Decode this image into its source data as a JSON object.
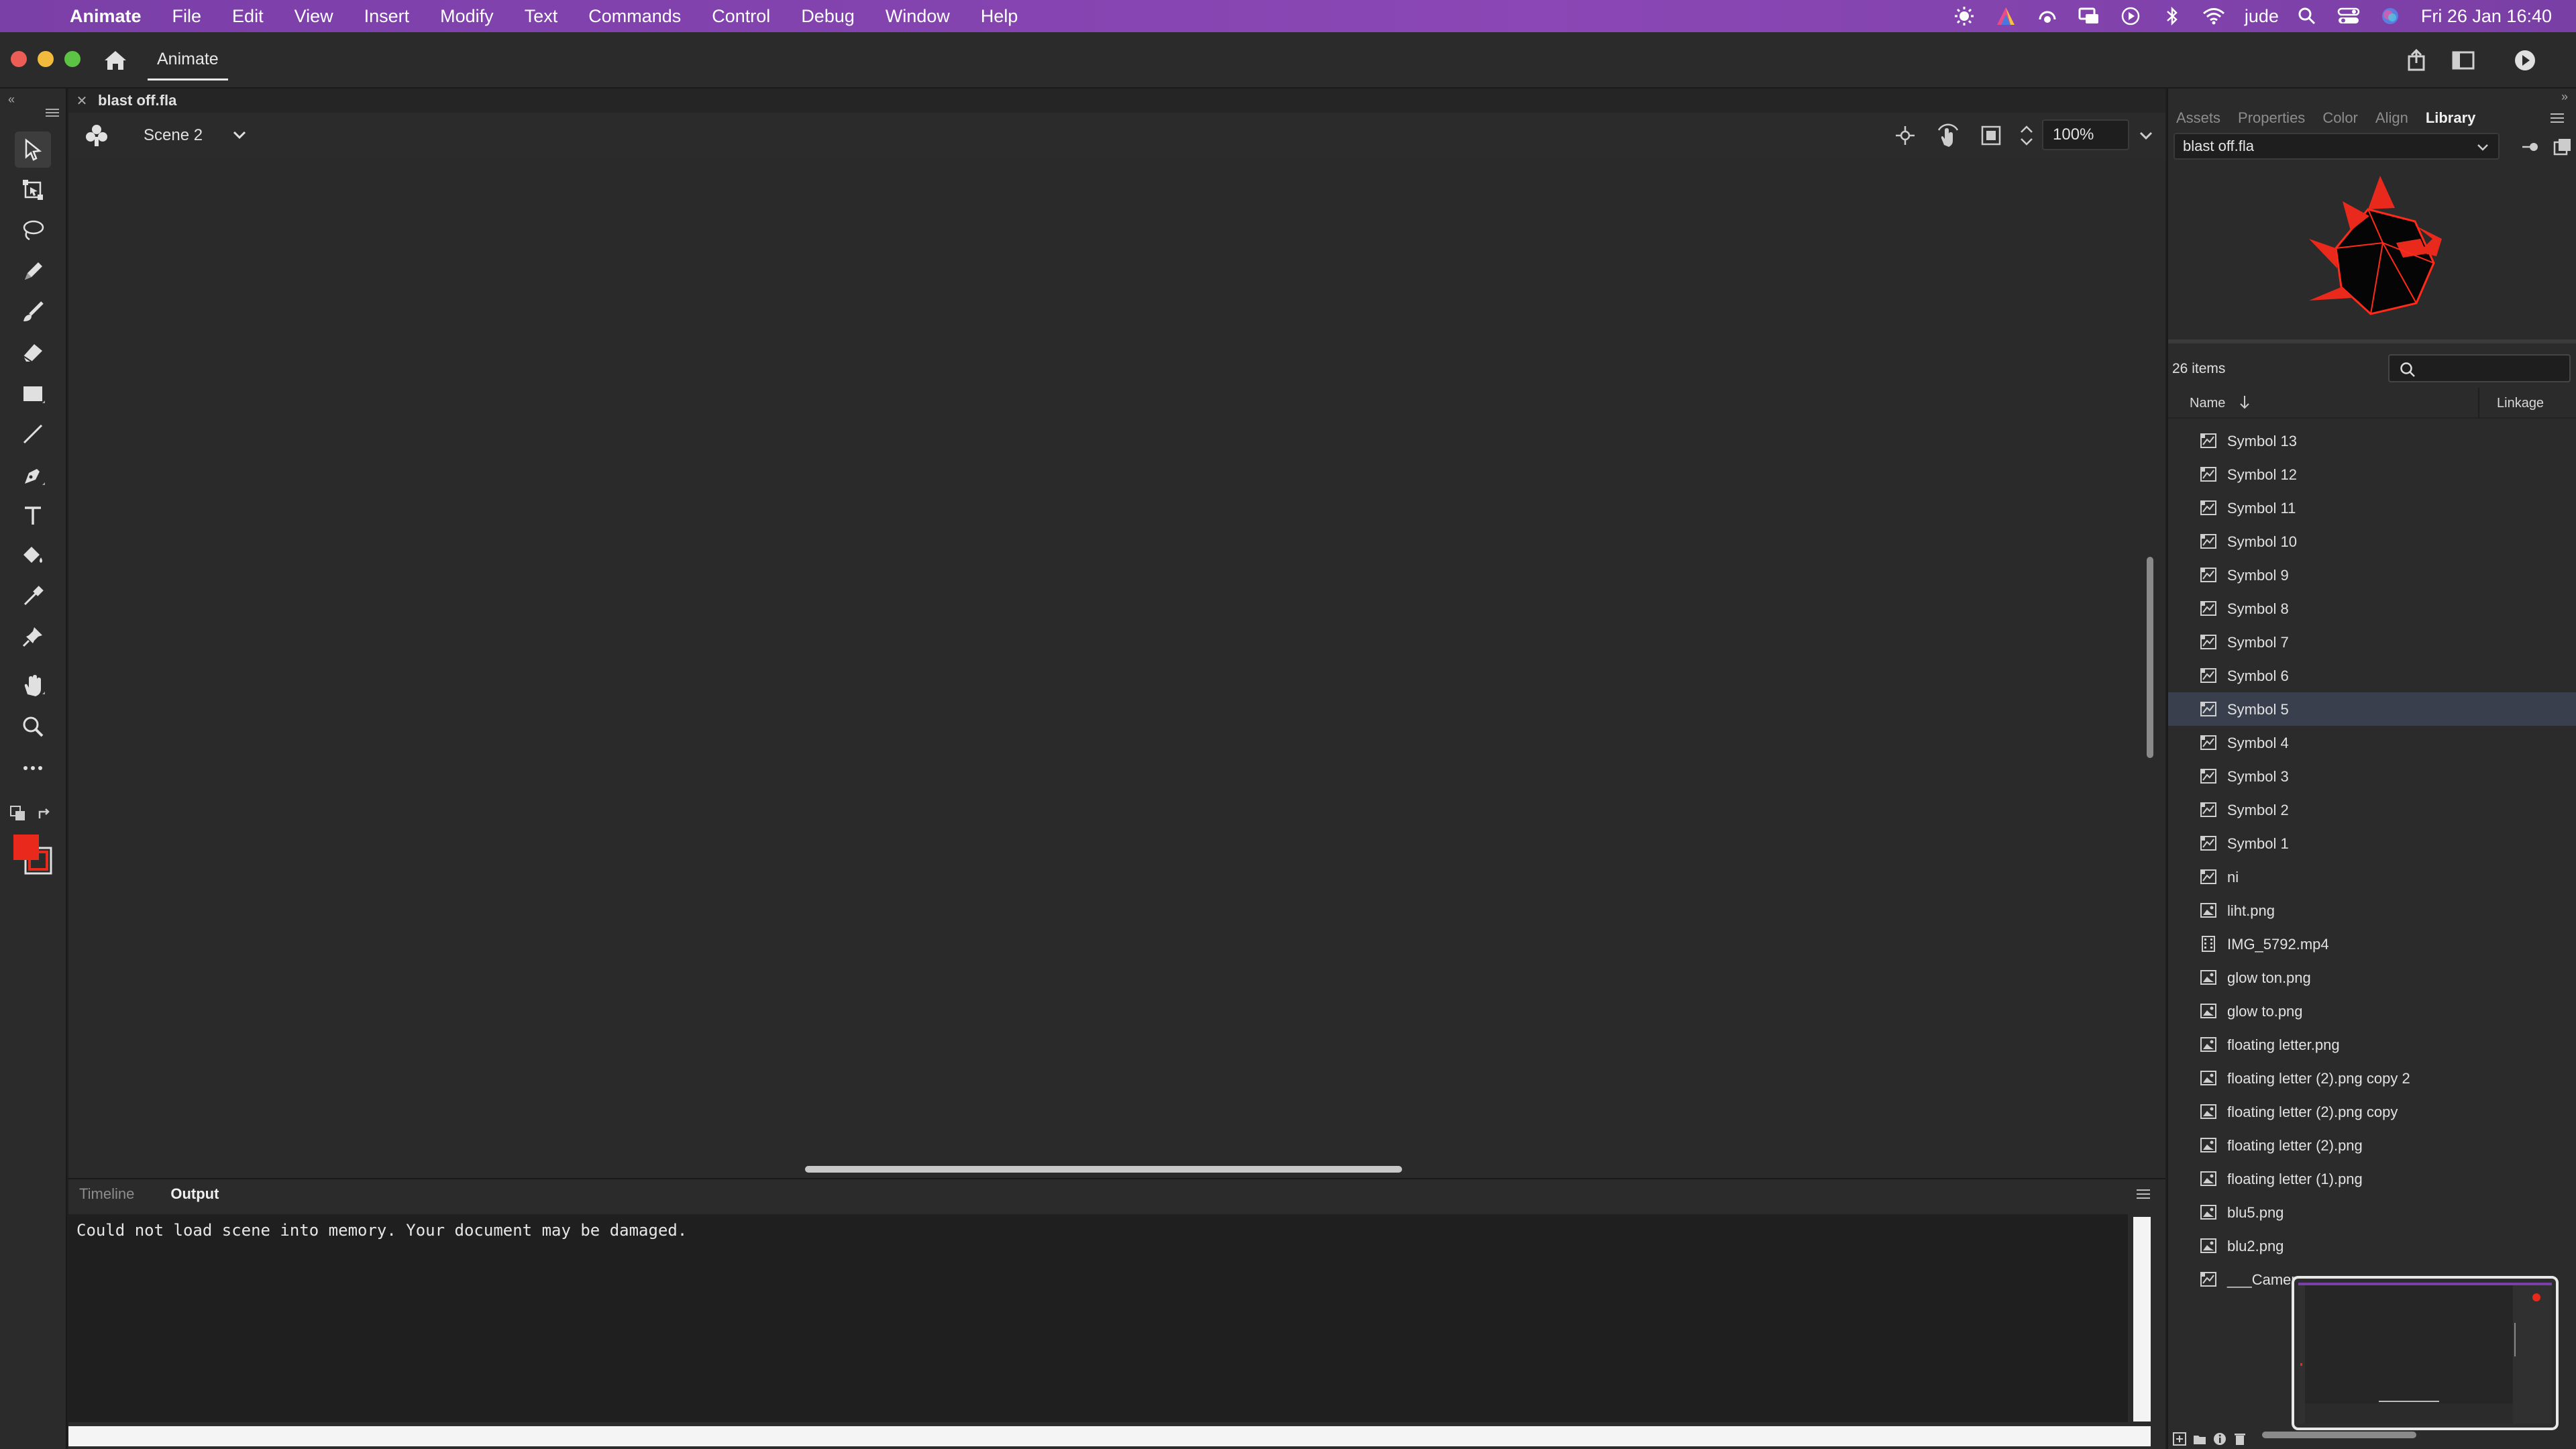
{
  "menubar": {
    "app_name": "Animate",
    "items": [
      "File",
      "Edit",
      "View",
      "Insert",
      "Modify",
      "Text",
      "Commands",
      "Control",
      "Debug",
      "Window",
      "Help"
    ],
    "user": "jude",
    "datetime": "Fri 26 Jan  16:40",
    "status_icons": [
      "brightness-icon",
      "creative-cloud-icon",
      "sync-icon",
      "screen-mirror-icon",
      "play-circle-icon",
      "bluetooth-icon",
      "wifi-icon",
      "search-icon",
      "control-center-icon",
      "siri-icon"
    ]
  },
  "appbar": {
    "tab_label": "Animate"
  },
  "document": {
    "tab_name": "blast off.fla",
    "scene": "Scene 2",
    "zoom": "100%"
  },
  "bottom_panel": {
    "tabs": [
      "Timeline",
      "Output"
    ],
    "active_tab": "Output",
    "output_text": "Could not load scene into memory. Your document may be damaged."
  },
  "right_panel": {
    "tabs": [
      "Assets",
      "Properties",
      "Color",
      "Align",
      "Library"
    ],
    "active_tab": "Library",
    "library_select": "blast off.fla",
    "items_count": "26 items",
    "col_name": "Name",
    "col_linkage": "Linkage",
    "items": [
      {
        "label": "Symbol 13",
        "kind": "symbol"
      },
      {
        "label": "Symbol 12",
        "kind": "symbol"
      },
      {
        "label": "Symbol 11",
        "kind": "symbol"
      },
      {
        "label": "Symbol 10",
        "kind": "symbol"
      },
      {
        "label": "Symbol 9",
        "kind": "symbol"
      },
      {
        "label": "Symbol 8",
        "kind": "symbol"
      },
      {
        "label": "Symbol 7",
        "kind": "symbol"
      },
      {
        "label": "Symbol 6",
        "kind": "symbol"
      },
      {
        "label": "Symbol 5",
        "kind": "symbol",
        "selected": true
      },
      {
        "label": "Symbol 4",
        "kind": "symbol"
      },
      {
        "label": "Symbol 3",
        "kind": "symbol"
      },
      {
        "label": "Symbol 2",
        "kind": "symbol"
      },
      {
        "label": "Symbol 1",
        "kind": "symbol"
      },
      {
        "label": "ni",
        "kind": "symbol"
      },
      {
        "label": "liht.png",
        "kind": "bitmap"
      },
      {
        "label": "IMG_5792.mp4",
        "kind": "video"
      },
      {
        "label": "glow ton.png",
        "kind": "bitmap"
      },
      {
        "label": "glow to.png",
        "kind": "bitmap"
      },
      {
        "label": "floating letter.png",
        "kind": "bitmap"
      },
      {
        "label": "floating letter (2).png copy 2",
        "kind": "bitmap"
      },
      {
        "label": "floating letter (2).png copy",
        "kind": "bitmap"
      },
      {
        "label": "floating letter (2).png",
        "kind": "bitmap"
      },
      {
        "label": "floating letter (1).png",
        "kind": "bitmap"
      },
      {
        "label": "blu5.png",
        "kind": "bitmap"
      },
      {
        "label": "blu2.png",
        "kind": "bitmap"
      },
      {
        "label": "___Camera",
        "kind": "symbol"
      }
    ]
  },
  "colors": {
    "fill": "#e8291c",
    "menubar": "#8445b0",
    "selection": "#3a3f4e"
  }
}
